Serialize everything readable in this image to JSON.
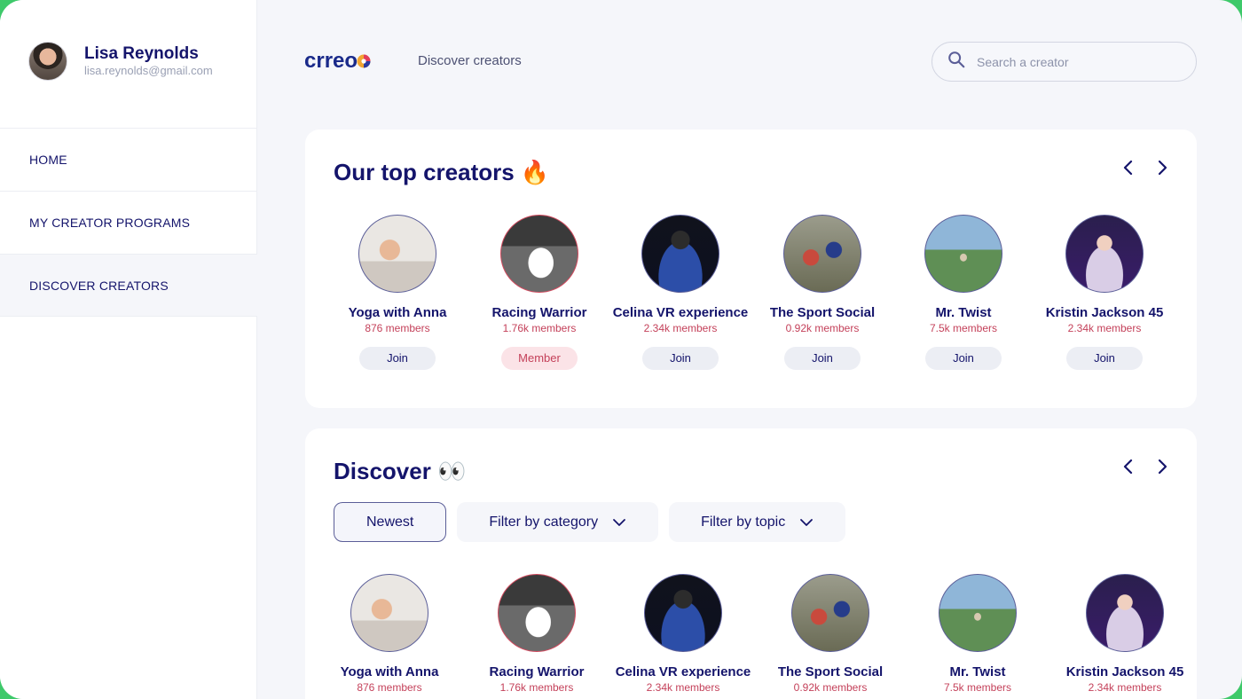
{
  "user": {
    "name": "Lisa Reynolds",
    "email": "lisa.reynolds@gmail.com"
  },
  "nav": {
    "items": [
      {
        "label": "HOME"
      },
      {
        "label": "MY CREATOR PROGRAMS"
      },
      {
        "label": "DISCOVER CREATORS",
        "active": true
      }
    ]
  },
  "header": {
    "brand": "crreo",
    "link": "Discover creators",
    "search_placeholder": "Search a creator"
  },
  "top_creators": {
    "title": "Our top creators 🔥",
    "items": [
      {
        "name": "Yoga with Anna",
        "members": "876 members",
        "button": "Join",
        "photo": "yoga"
      },
      {
        "name": "Racing Warrior",
        "members": "1.76k members",
        "button": "Member",
        "photo": "race"
      },
      {
        "name": "Celina VR experience",
        "members": "2.34k members",
        "button": "Join",
        "photo": "vr"
      },
      {
        "name": "The Sport Social",
        "members": "0.92k members",
        "button": "Join",
        "photo": "sport"
      },
      {
        "name": "Mr. Twist",
        "members": "7.5k members",
        "button": "Join",
        "photo": "twist"
      },
      {
        "name": "Kristin Jackson 45",
        "members": "2.34k members",
        "button": "Join",
        "photo": "kristin"
      }
    ]
  },
  "discover": {
    "title": "Discover 👀",
    "filters": {
      "newest": "Newest",
      "category": "Filter by category",
      "topic": "Filter by topic"
    },
    "items": [
      {
        "name": "Yoga with Anna",
        "members": "876 members",
        "photo": "yoga"
      },
      {
        "name": "Racing Warrior",
        "members": "1.76k members",
        "photo": "race"
      },
      {
        "name": "Celina VR experience",
        "members": "2.34k members",
        "photo": "vr"
      },
      {
        "name": "The Sport Social",
        "members": "0.92k members",
        "photo": "sport"
      },
      {
        "name": "Mr. Twist",
        "members": "7.5k members",
        "photo": "twist"
      },
      {
        "name": "Kristin Jackson 45",
        "members": "2.34k members",
        "photo": "kristin"
      }
    ]
  },
  "colors": {
    "primary": "#14146b",
    "accent": "#c4415a",
    "background": "#f5f6fa",
    "frame": "#3ec96a"
  }
}
